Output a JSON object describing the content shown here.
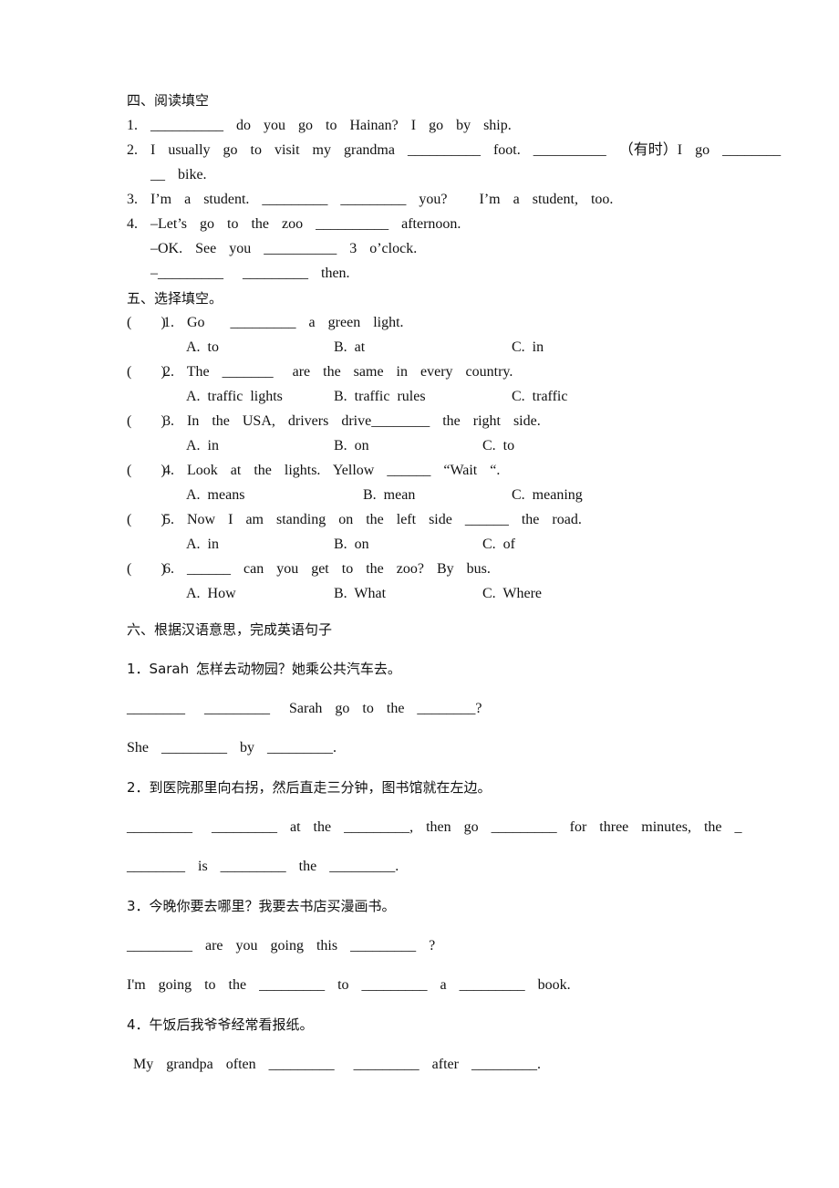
{
  "section4": {
    "heading": "四、阅读填空",
    "lines": [
      "1.  __________  do  you  go  to  Hainan?  I  go  by  ship.",
      "2.  I  usually  go  to  visit  my  grandma  __________  foot.  __________  （有时）I  go  ________",
      "__  bike.",
      "3.  I’m  a  student.  _________  _________  you?     I’m  a  student,  too.",
      "4.  –Let’s  go  to  the  zoo  __________  afternoon.",
      "–OK.  See  you  __________  3  o’clock.",
      "–_________   _________  then."
    ]
  },
  "section5": {
    "heading": "五、选择填空。",
    "questions": [
      {
        "paren": "(        )",
        "text": "1.  Go    _________  a  green  light.",
        "options": [
          "A.  to",
          "B.  at",
          "C.  in"
        ]
      },
      {
        "paren": "(        )",
        "text": "2.  The  _______   are  the  same  in  every  country.",
        "options": [
          "A.  traffic  lights",
          "B.  traffic  rules",
          "C.  traffic"
        ]
      },
      {
        "paren": "(        )",
        "text": "3.  In  the  USA,  drivers  drive________  the  right  side.",
        "options": [
          "A.  in",
          "B.  on",
          "C.  to"
        ]
      },
      {
        "paren": "(        )",
        "text": "4.  Look  at  the  lights.  Yellow  ______  “Wait  “.",
        "options": [
          "A.  means",
          "B.  mean",
          "C.  meaning"
        ]
      },
      {
        "paren": "(        )",
        "text": "5.  Now  I  am  standing  on  the  left  side  ______  the  road.",
        "options": [
          "A.  in",
          "B.  on",
          "C.  of"
        ]
      },
      {
        "paren": "(        )",
        "text": "6.  ______  can  you  get  to  the  zoo?  By  bus.",
        "options": [
          "A.  How",
          "B.  What",
          "C.  Where"
        ]
      }
    ]
  },
  "section6": {
    "heading": "六、根据汉语意思，完成英语句子",
    "items": [
      {
        "prompt": "1．Sarah 怎样去动物园？她乘公共汽车去。",
        "answers": [
          "________   _________   Sarah  go  to  the  ________?",
          "She  _________  by  _________."
        ]
      },
      {
        "prompt": "2．到医院那里向右拐，然后直走三分钟，图书馆就在左边。",
        "answers": [
          "_________   _________  at  the  _________,  then  go  _________  for  three  minutes,  the  _",
          "________  is  _________  the  _________."
        ]
      },
      {
        "prompt": "3．今晚你要去哪里？我要去书店买漫画书。",
        "answers": [
          "_________  are  you  going  this  _________  ?",
          "I'm  going  to  the  _________  to  _________  a  _________  book."
        ]
      },
      {
        "prompt": "4．午饭后我爷爷经常看报纸。",
        "answers": [
          " My  grandpa  often  _________   _________  after  _________."
        ]
      }
    ]
  }
}
